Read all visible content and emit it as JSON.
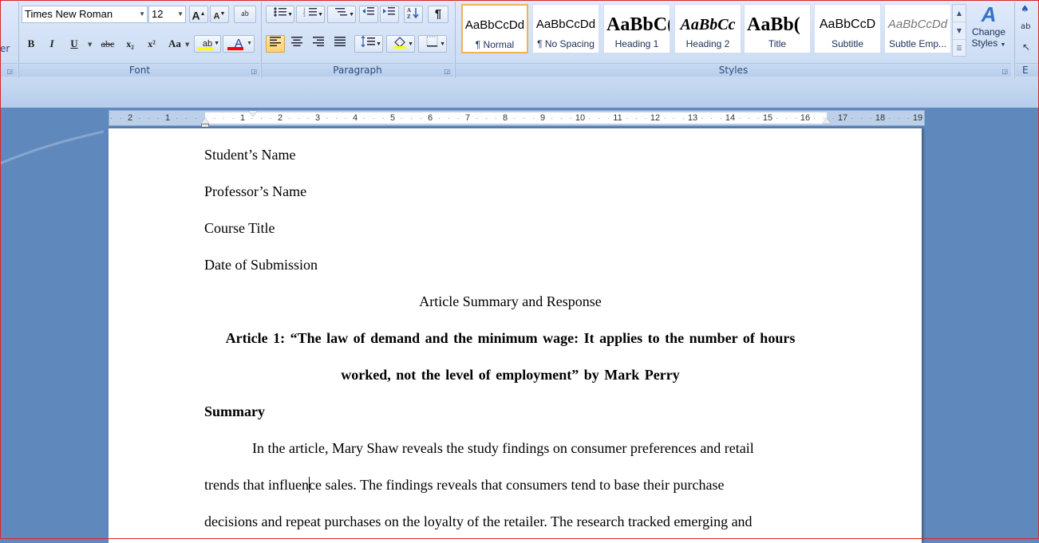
{
  "ribbon": {
    "left_group_tail": "er",
    "font_group": {
      "label": "Font",
      "font_name": "Times New Roman",
      "font_size": "12",
      "grow_label": "A",
      "shrink_label": "A",
      "clear_label": "ab",
      "bold": "B",
      "italic": "I",
      "underline": "U",
      "strike": "abc",
      "subscript": "x₂",
      "superscript": "x²",
      "change_case": "Aa",
      "highlight": "ab",
      "font_color": "A"
    },
    "paragraph_group": {
      "label": "Paragraph",
      "show_marks": "¶"
    },
    "styles_group": {
      "label": "Styles",
      "styles": [
        {
          "sample": "AaBbCcDd",
          "name": "¶ Normal"
        },
        {
          "sample": "AaBbCcDd",
          "name": "¶ No Spacing"
        },
        {
          "sample": "AaBbC(",
          "name": "Heading 1"
        },
        {
          "sample": "AaBbCc",
          "name": "Heading 2"
        },
        {
          "sample": "AaBb(",
          "name": "Title"
        },
        {
          "sample": "AaBbCcD",
          "name": "Subtitle"
        },
        {
          "sample": "AaBbCcDd",
          "name": "Subtle Emp..."
        }
      ],
      "change_styles_line1": "Change",
      "change_styles_line2": "Styles"
    },
    "editing_group_tail": "E"
  },
  "ruler": {
    "labels": [
      "2",
      "1",
      "1",
      "2",
      "3",
      "4",
      "5",
      "6",
      "7",
      "8",
      "9",
      "10",
      "11",
      "12",
      "13",
      "14",
      "15",
      "16",
      "17",
      "18",
      "19"
    ]
  },
  "document": {
    "line1": "Student’s Name",
    "line2": "Professor’s Name",
    "line3": "Course Title",
    "line4": "Date of Submission",
    "title": "Article Summary and Response",
    "article_heading_1": "Article 1: “The law of demand and the minimum wage: It applies to the number of hours",
    "article_heading_2": "worked, not the level of employment” by Mark Perry",
    "summary_heading": "Summary",
    "body_1": "In the article, Mary Shaw reveals the study findings on consumer preferences and retail",
    "body_2a": "trends that influen",
    "body_2b": "ce sales. The findings reveals that consumers tend to base their purchase",
    "body_3": "decisions and repeat purchases on the loyalty of the retailer. The research tracked emerging and"
  },
  "colors": {
    "highlight": "#ffff00",
    "font_color": "#ff0000",
    "workspace": "#5f88bd"
  }
}
